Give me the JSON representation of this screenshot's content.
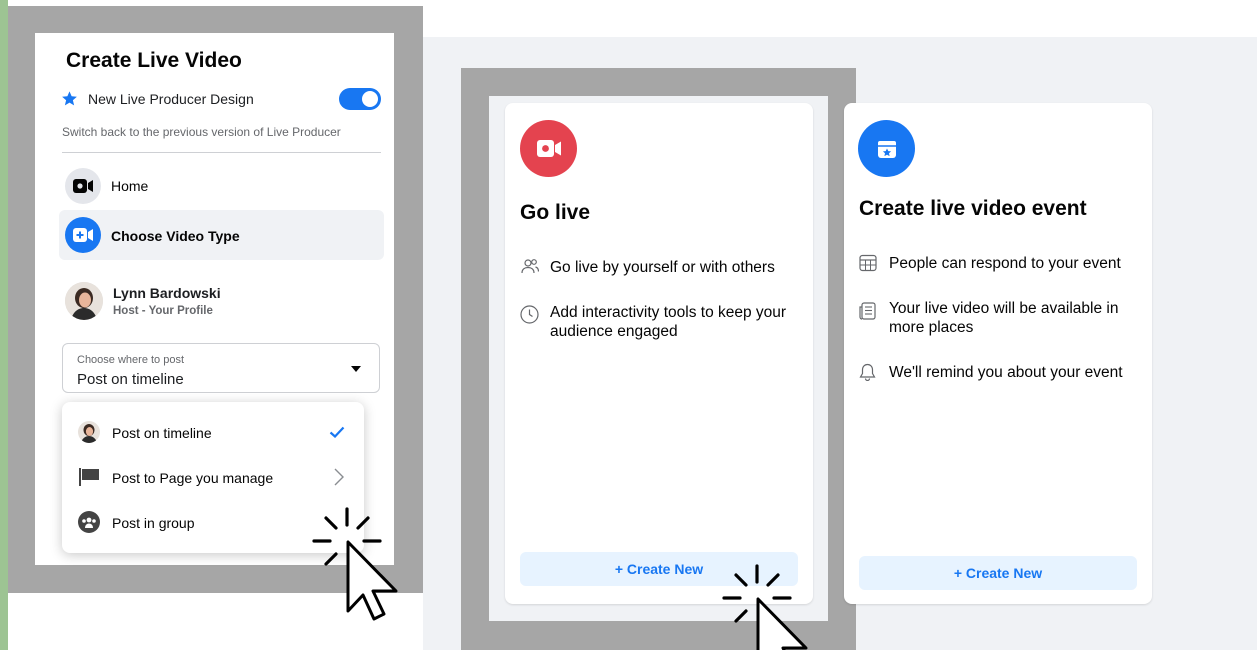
{
  "left_panel": {
    "title": "Create Live Video",
    "new_design_label": "New Live Producer Design",
    "switch_back_text": "Switch back to the previous version of Live Producer",
    "nav": [
      {
        "label": "Home",
        "icon": "video-camera-icon"
      },
      {
        "label": "Choose Video Type",
        "icon": "video-add-icon"
      }
    ],
    "host": {
      "name": "Lynn Bardowski",
      "role": "Host - Your Profile"
    },
    "post_select": {
      "label": "Choose where to post",
      "value": "Post on timeline"
    },
    "post_options": [
      {
        "label": "Post on timeline",
        "icon": "avatar",
        "trailing": "check-icon"
      },
      {
        "label": "Post to Page you manage",
        "icon": "flag-icon",
        "trailing": "chevron-right-icon"
      },
      {
        "label": "Post in group",
        "icon": "group-icon",
        "trailing": "chevron-right-icon"
      }
    ]
  },
  "cards": [
    {
      "title": "Go live",
      "icon": "live-camera-icon",
      "icon_color": "#e4434f",
      "features": [
        {
          "icon": "people-icon",
          "text": "Go live by yourself or with others"
        },
        {
          "icon": "clock-icon",
          "text": "Add interactivity tools to keep your audience engaged"
        }
      ],
      "button": "+ Create New"
    },
    {
      "title": "Create live video event",
      "icon": "calendar-star-icon",
      "icon_color": "#1877f2",
      "features": [
        {
          "icon": "calendar-grid-icon",
          "text": "People can respond to your event"
        },
        {
          "icon": "newspaper-icon",
          "text": "Your live video will be available in more places"
        },
        {
          "icon": "bell-icon",
          "text": "We'll remind you about your event"
        }
      ],
      "button": "+ Create New"
    }
  ],
  "colors": {
    "accent": "#1877f2",
    "live_red": "#e4434f",
    "highlight_frame": "#a6a6a6",
    "page_bg": "#f0f2f5"
  }
}
